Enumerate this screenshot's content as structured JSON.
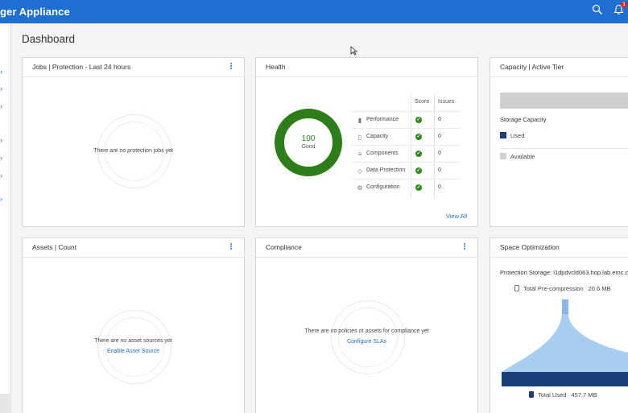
{
  "header": {
    "app_title": "ger Appliance",
    "notification_count": "1"
  },
  "page": {
    "title": "Dashboard"
  },
  "cards": {
    "jobs": {
      "title": "Jobs | Protection - Last 24 hours",
      "empty_text": "There are no protection jobs yet"
    },
    "health": {
      "title": "Health",
      "score": "100",
      "status": "Good",
      "score_fraction": 1.0,
      "columns": {
        "score": "Score",
        "issues": "Issues"
      },
      "rows": [
        {
          "label": "Performance",
          "icon": "bar-chart-icon",
          "issues": "0"
        },
        {
          "label": "Capacity",
          "icon": "cylinder-icon",
          "issues": "0"
        },
        {
          "label": "Components",
          "icon": "list-icon",
          "issues": "0"
        },
        {
          "label": "Data Protection",
          "icon": "shield-icon",
          "issues": "0"
        },
        {
          "label": "Configuration",
          "icon": "gear-icon",
          "issues": "0"
        }
      ],
      "view_all": "View All"
    },
    "capacity": {
      "title": "Capacity | Active Tier",
      "storage_label": "Storage Capacity",
      "legend": [
        {
          "label": "Used",
          "color": "#1b3f7a"
        },
        {
          "label": "Available",
          "color": "#cfcfcf"
        }
      ]
    },
    "assets": {
      "title": "Assets | Count",
      "empty_text": "There are no asset sources yet",
      "link": "Enable Asset Source"
    },
    "compliance": {
      "title": "Compliance",
      "empty_text": "There are no policies or assets for compliance yet",
      "link": "Configure SLAs"
    },
    "space": {
      "title": "Space Optimization",
      "protection_storage": "Protection Storage: l1dpdvcld063.hop.lab.emc.c",
      "pre_label": "Total Pre-compression",
      "pre_value": "20.6 MB",
      "used_label": "Total Used",
      "used_value": "457.7 MB"
    }
  },
  "colors": {
    "brand": "#1e6fd1",
    "health_good": "#2e7d1b",
    "used": "#1b3f7a",
    "funnel": "#a9cdee"
  }
}
